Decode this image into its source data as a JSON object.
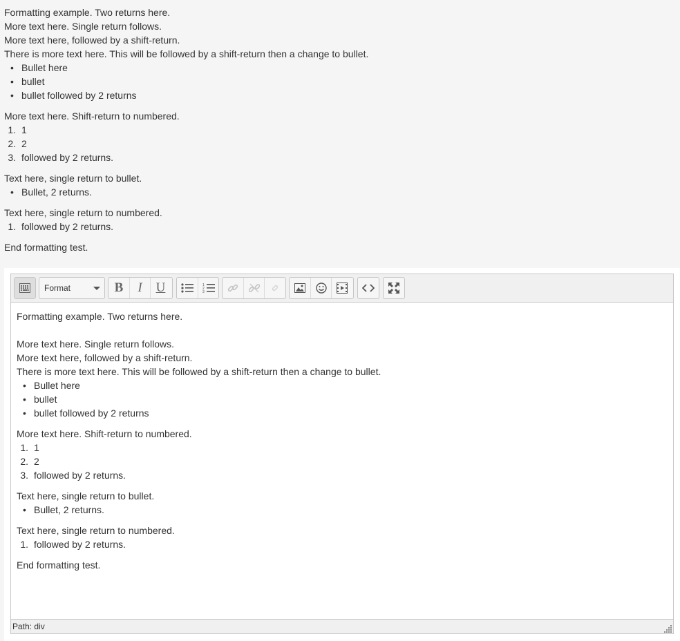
{
  "paragraphs": {
    "p1": "Formatting example. Two returns here.",
    "p2": "More text here. Single return follows.",
    "p3": "More text here, followed by a shift-return.",
    "p4": "There is more text here. This will be followed by a shift-return then a change to bullet.",
    "bullets1": [
      "Bullet here",
      "bullet",
      "bullet followed by 2 returns"
    ],
    "p5": "More text here. Shift-return to numbered.",
    "numbered1": [
      {
        "num": "1.",
        "text": "1"
      },
      {
        "num": "2.",
        "text": "2"
      },
      {
        "num": "3.",
        "text": "followed by 2 returns."
      }
    ],
    "p6": "Text here, single return to bullet.",
    "bullets2": [
      "Bullet, 2 returns."
    ],
    "p7": "Text here, single return to numbered.",
    "numbered2": [
      {
        "num": "1.",
        "text": "followed by 2 returns."
      }
    ],
    "p8": "End formatting test."
  },
  "toolbar": {
    "format_label": "Format",
    "bold_glyph": "B",
    "italic_glyph": "I",
    "underline_glyph": "U",
    "icons": [
      "toolbar-toggle-icon",
      "bullet-list-icon",
      "numbered-list-icon",
      "link-icon",
      "unlink-icon",
      "anchor-icon",
      "image-icon",
      "emoticon-icon",
      "media-icon",
      "html-icon",
      "fullscreen-icon"
    ]
  },
  "status": {
    "path": "Path: div"
  },
  "colors": {
    "page_bg": "#f5f5f5",
    "toolbar_bg": "#f0f0f0",
    "border": "#c5c5c5"
  }
}
